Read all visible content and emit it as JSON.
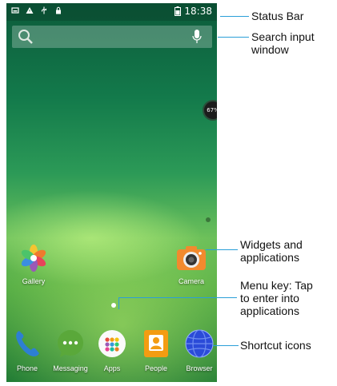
{
  "status_bar": {
    "time": "18:38",
    "left_icons": [
      "notification-icon",
      "warning-icon",
      "usb-icon",
      "lock-icon"
    ],
    "right_icons": [
      "battery-icon"
    ]
  },
  "search": {
    "placeholder": ""
  },
  "battery_widget": {
    "percent_label": "67%"
  },
  "apps": [
    {
      "label": "Gallery",
      "icon": "gallery-icon"
    },
    {
      "label": "Camera",
      "icon": "camera-icon"
    }
  ],
  "dock": [
    {
      "label": "Phone",
      "icon": "phone-icon"
    },
    {
      "label": "Messaging",
      "icon": "messaging-icon"
    },
    {
      "label": "Apps",
      "icon": "apps-icon"
    },
    {
      "label": "People",
      "icon": "people-icon"
    },
    {
      "label": "Browser",
      "icon": "browser-icon"
    }
  ],
  "callouts": {
    "status_bar": "Status Bar",
    "search": "Search input\nwindow",
    "widgets": "Widgets and\napplications",
    "menu_key": "Menu key: Tap\nto enter into\napplications",
    "shortcuts": "Shortcut icons"
  },
  "colors": {
    "callout_line": "#2a9fd8"
  }
}
